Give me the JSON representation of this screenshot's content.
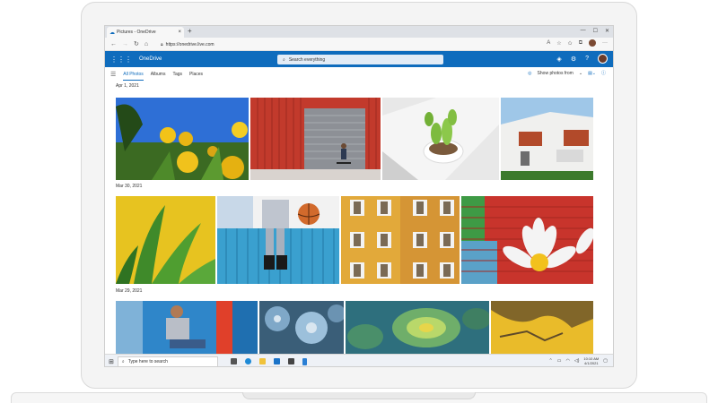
{
  "browser": {
    "tab_title": "Pictures - OneDrive",
    "tab_close": "×",
    "new_tab": "+",
    "window_controls": [
      "—",
      "☐",
      "✕"
    ],
    "url": "https://onedrive.live.com"
  },
  "onedrive": {
    "app_name": "OneDrive",
    "search_placeholder": "Search everything"
  },
  "subnav": {
    "tabs": [
      "All Photos",
      "Albums",
      "Tags",
      "Places"
    ],
    "active_tab": "All Photos",
    "show_photos_from": "Show photos from"
  },
  "groups": [
    {
      "date": "Apr 1, 2021"
    },
    {
      "date": "Mar 30, 2021"
    },
    {
      "date": "Mar 29, 2021"
    }
  ],
  "taskbar": {
    "search_placeholder": "Type here to search",
    "time": "10:10 AM",
    "date": "4/1/2021"
  },
  "colors": {
    "accent": "#0f6cbd",
    "header_bg": "#0f6cbd",
    "taskbar_bg": "#eef1f6"
  },
  "icons": [
    "edge-cloud-icon",
    "back-icon",
    "forward-icon",
    "refresh-icon",
    "home-icon",
    "lock-icon",
    "favorites-icon",
    "collections-icon",
    "profile-icon",
    "more-icon",
    "waffle-icon",
    "search-icon",
    "network-icon",
    "settings-icon",
    "help-icon",
    "avatar",
    "hamburger-icon",
    "filter-icon",
    "view-icon",
    "info-icon",
    "windows-start-icon",
    "task-view-icon",
    "edge-icon",
    "file-explorer-icon",
    "mail-icon",
    "store-icon",
    "phone-icon"
  ]
}
